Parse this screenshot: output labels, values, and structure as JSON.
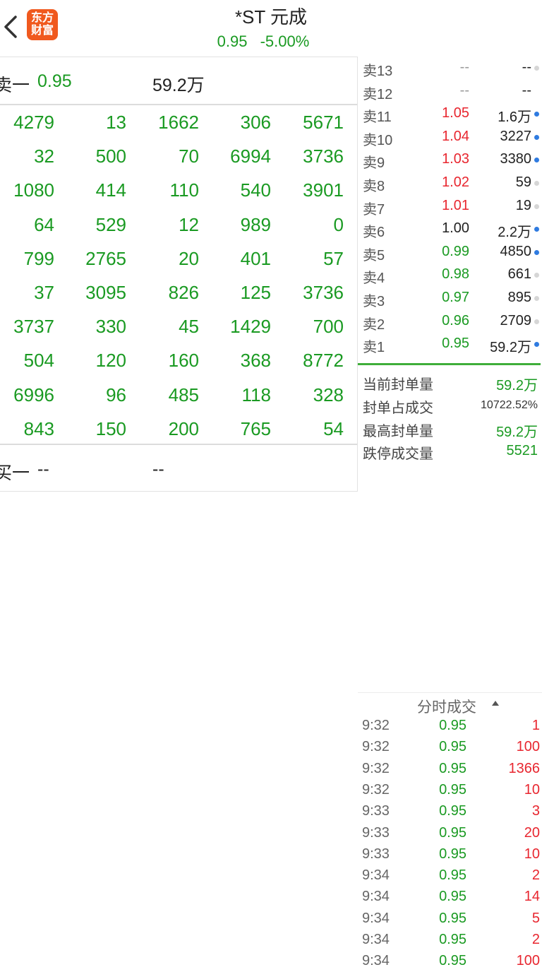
{
  "header": {
    "title": "*ST 元成",
    "price": "0.95",
    "change_pct": "-5.00%",
    "logo_line1": "东方",
    "logo_line2": "财富"
  },
  "left_panel": {
    "top_row": {
      "label": "卖一",
      "price": "0.95",
      "volume": "59.2万"
    },
    "grid_rows": [
      [
        "4279",
        "13",
        "1662",
        "306",
        "5671"
      ],
      [
        "32",
        "500",
        "70",
        "6994",
        "3736"
      ],
      [
        "1080",
        "414",
        "110",
        "540",
        "3901"
      ],
      [
        "64",
        "529",
        "12",
        "989",
        "0"
      ],
      [
        "799",
        "2765",
        "20",
        "401",
        "57"
      ],
      [
        "37",
        "3095",
        "826",
        "125",
        "3736"
      ],
      [
        "3737",
        "330",
        "45",
        "1429",
        "700"
      ],
      [
        "504",
        "120",
        "160",
        "368",
        "8772"
      ],
      [
        "6996",
        "96",
        "485",
        "118",
        "328"
      ],
      [
        "843",
        "150",
        "200",
        "765",
        "54"
      ]
    ],
    "bottom_row": {
      "label": "买一",
      "price": "--",
      "volume": "--"
    }
  },
  "order_book": {
    "asks": [
      {
        "label": "卖13",
        "price": "--",
        "qty": "--",
        "price_color": "gray",
        "qty_color": "gray",
        "dot": "light"
      },
      {
        "label": "卖12",
        "price": "--",
        "qty": "--",
        "price_color": "gray",
        "qty_color": "gray",
        "dot": "none"
      },
      {
        "label": "卖11",
        "price": "1.05",
        "qty": "1.6万",
        "price_color": "red",
        "qty_color": "dark",
        "dot": "blue"
      },
      {
        "label": "卖10",
        "price": "1.04",
        "qty": "3227",
        "price_color": "red",
        "qty_color": "dark",
        "dot": "blue"
      },
      {
        "label": "卖9",
        "price": "1.03",
        "qty": "3380",
        "price_color": "red",
        "qty_color": "dark",
        "dot": "blue"
      },
      {
        "label": "卖8",
        "price": "1.02",
        "qty": "59",
        "price_color": "red",
        "qty_color": "dark",
        "dot": "light"
      },
      {
        "label": "卖7",
        "price": "1.01",
        "qty": "19",
        "price_color": "red",
        "qty_color": "dark",
        "dot": "light"
      },
      {
        "label": "卖6",
        "price": "1.00",
        "qty": "2.2万",
        "price_color": "dark",
        "qty_color": "dark",
        "dot": "blue"
      },
      {
        "label": "卖5",
        "price": "0.99",
        "qty": "4850",
        "price_color": "green",
        "qty_color": "dark",
        "dot": "blue"
      },
      {
        "label": "卖4",
        "price": "0.98",
        "qty": "661",
        "price_color": "green",
        "qty_color": "dark",
        "dot": "light"
      },
      {
        "label": "卖3",
        "price": "0.97",
        "qty": "895",
        "price_color": "green",
        "qty_color": "dark",
        "dot": "light"
      },
      {
        "label": "卖2",
        "price": "0.96",
        "qty": "2709",
        "price_color": "green",
        "qty_color": "dark",
        "dot": "light"
      },
      {
        "label": "卖1",
        "price": "0.95",
        "qty": "59.2万",
        "price_color": "green",
        "qty_color": "dark",
        "dot": "blue"
      }
    ],
    "stats": [
      {
        "label": "当前封单量",
        "value": "59.2万",
        "style": "green"
      },
      {
        "label": "封单占成交",
        "value": "10722.52%",
        "style": "small"
      },
      {
        "label": "最高封单量",
        "value": "59.2万",
        "style": "green"
      },
      {
        "label": "跌停成交量",
        "value": "5521",
        "style": "green"
      }
    ]
  },
  "ticks": {
    "title": "分时成交",
    "rows": [
      {
        "time": "9:32",
        "price": "0.95",
        "vol": "1"
      },
      {
        "time": "9:32",
        "price": "0.95",
        "vol": "100"
      },
      {
        "time": "9:32",
        "price": "0.95",
        "vol": "1366"
      },
      {
        "time": "9:32",
        "price": "0.95",
        "vol": "10"
      },
      {
        "time": "9:33",
        "price": "0.95",
        "vol": "3"
      },
      {
        "time": "9:33",
        "price": "0.95",
        "vol": "20"
      },
      {
        "time": "9:33",
        "price": "0.95",
        "vol": "10"
      },
      {
        "time": "9:34",
        "price": "0.95",
        "vol": "2"
      },
      {
        "time": "9:34",
        "price": "0.95",
        "vol": "14"
      },
      {
        "time": "9:34",
        "price": "0.95",
        "vol": "5"
      },
      {
        "time": "9:34",
        "price": "0.95",
        "vol": "2"
      },
      {
        "time": "9:34",
        "price": "0.95",
        "vol": "100"
      }
    ]
  },
  "colors": {
    "green": "#1a9a22",
    "red": "#e8262f",
    "blue_dot": "#2f7be0",
    "logo": "#f0591e"
  }
}
